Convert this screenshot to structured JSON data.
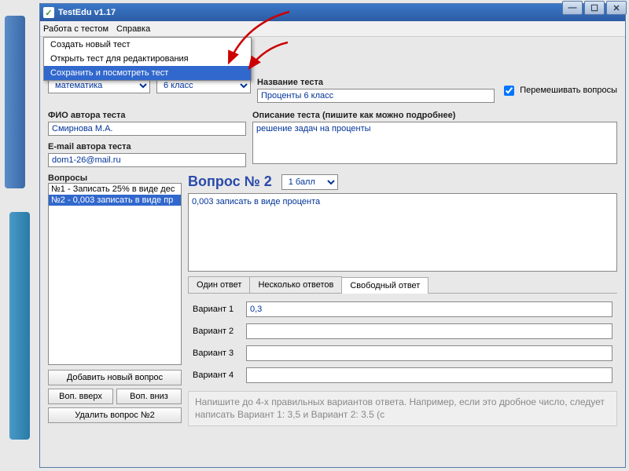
{
  "title": "TestEdu v1.17",
  "menu": {
    "m1": "Работа с тестом",
    "m2": "Справка"
  },
  "dropdown": {
    "i0": "Создать новый тест",
    "i1": "Открыть тест для редактирования",
    "i2": "Сохранить и посмотреть тест"
  },
  "subjects": {
    "value": "математика"
  },
  "grade": {
    "value": "6 класс"
  },
  "testNameLabel": "Название теста",
  "testName": "Проценты 6 класс",
  "shuffleLabel": "Перемешивать вопросы",
  "authorLabel": "ФИО автора теста",
  "author": "Смирнова М.А.",
  "emailLabel": "E-mail автора теста",
  "email": "dom1-26@mail.ru",
  "descLabel": "Описание теста (пишите как можно подробнее)",
  "desc": "решение задач на проценты",
  "questionsLabel": "Вопросы",
  "qlist": {
    "q0": "№1 - Записать 25% в виде дес",
    "q1": "№2 - 0,003 записать в виде пр"
  },
  "addBtn": "Добавить новый вопрос",
  "upBtn": "Воп. вверх",
  "downBtn": "Воп. вниз",
  "delBtn": "Удалить вопрос №2",
  "qTitle": "Вопрос № 2",
  "scoreSel": "1 балл",
  "qText": "0,003 записать в виде процента",
  "tabs": {
    "t0": "Один ответ",
    "t1": "Несколько ответов",
    "t2": "Свободный ответ"
  },
  "v": {
    "l1": "Вариант 1",
    "l2": "Вариант 2",
    "l3": "Вариант 3",
    "l4": "Вариант 4",
    "v1": "0,3"
  },
  "hint": "Напишите до 4-х правильных вариантов ответа. Например, если это\nдробное число, следует написать Вариант 1: 3,5 и Вариант 2: 3.5 (с"
}
